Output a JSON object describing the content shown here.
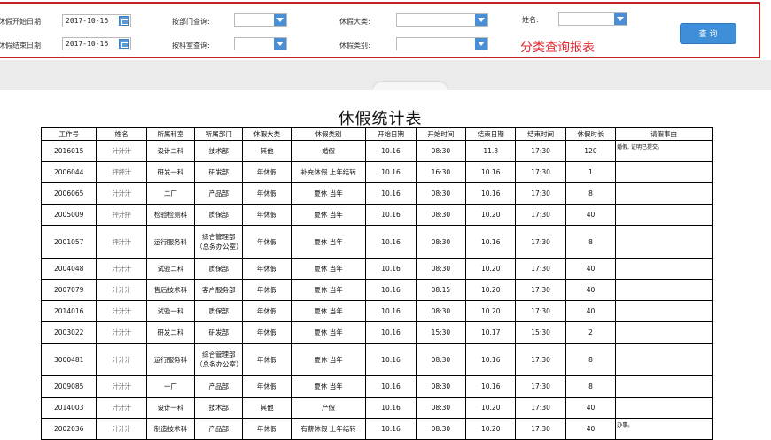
{
  "filters": {
    "start_date_label": "休假开始日期",
    "start_date_value": "2017-10-16",
    "end_date_label": "休假结束日期",
    "end_date_value": "2017-10-16",
    "dept_label": "按部门查询:",
    "section_label": "按科室查询:",
    "leave_cat_label": "休假大类:",
    "leave_type_label": "休假类别:",
    "name_label": "姓名:",
    "query_button": "查 询",
    "report_title": "分类查询报表"
  },
  "report": {
    "title": "休假统计表",
    "columns": [
      "工作号",
      "姓名",
      "所属科室",
      "所属部门",
      "休假大类",
      "休假类别",
      "开始日期",
      "开始时间",
      "结束日期",
      "结束时间",
      "休假时长",
      "请假事由"
    ],
    "rows": [
      {
        "id": "2016015",
        "name": "汁汁汁",
        "section": "设计二科",
        "dept": "技术部",
        "cat": "其他",
        "type": "婚假",
        "sdate": "10.16",
        "stime": "08:30",
        "edate": "11.3",
        "etime": "17:30",
        "hours": "120",
        "reason": "婚假, 证明已提交。"
      },
      {
        "id": "2006044",
        "name": "抨抨汁",
        "section": "研发一科",
        "dept": "研发部",
        "cat": "年休假",
        "type": "补充休假 上年结转",
        "sdate": "10.16",
        "stime": "16:30",
        "edate": "10.16",
        "etime": "17:30",
        "hours": "1",
        "reason": ""
      },
      {
        "id": "2006065",
        "name": "汁汁汁",
        "section": "二厂",
        "dept": "产品部",
        "cat": "年休假",
        "type": "夏休 当年",
        "sdate": "10.16",
        "stime": "08:30",
        "edate": "10.16",
        "etime": "17:30",
        "hours": "8",
        "reason": ""
      },
      {
        "id": "2005009",
        "name": "抨汁抨",
        "section": "检验检测科",
        "dept": "质保部",
        "cat": "年休假",
        "type": "夏休 当年",
        "sdate": "10.16",
        "stime": "08:30",
        "edate": "10.20",
        "etime": "17:30",
        "hours": "40",
        "reason": ""
      },
      {
        "id": "2001057",
        "name": "抨汁汁",
        "section": "运行服务科",
        "dept": "综合管理部（总务办公室）",
        "cat": "年休假",
        "type": "夏休 当年",
        "sdate": "10.16",
        "stime": "08:30",
        "edate": "10.16",
        "etime": "17:30",
        "hours": "8",
        "reason": "",
        "tall": true
      },
      {
        "id": "2004048",
        "name": "汁汁汁",
        "section": "试验二科",
        "dept": "质保部",
        "cat": "年休假",
        "type": "夏休 当年",
        "sdate": "10.16",
        "stime": "08:30",
        "edate": "10.20",
        "etime": "17:30",
        "hours": "40",
        "reason": ""
      },
      {
        "id": "2007079",
        "name": "汁汁汁",
        "section": "售后技术科",
        "dept": "客户服务部",
        "cat": "年休假",
        "type": "夏休 当年",
        "sdate": "10.16",
        "stime": "08:15",
        "edate": "10.20",
        "etime": "17:30",
        "hours": "40",
        "reason": ""
      },
      {
        "id": "2014016",
        "name": "汁汁汁",
        "section": "试验一科",
        "dept": "质保部",
        "cat": "年休假",
        "type": "夏休 当年",
        "sdate": "10.16",
        "stime": "08:30",
        "edate": "10.20",
        "etime": "17:30",
        "hours": "40",
        "reason": ""
      },
      {
        "id": "2003022",
        "name": "汁汁汁",
        "section": "研发二科",
        "dept": "研发部",
        "cat": "年休假",
        "type": "夏休 当年",
        "sdate": "10.16",
        "stime": "15:30",
        "edate": "10.17",
        "etime": "15:30",
        "hours": "2",
        "reason": ""
      },
      {
        "id": "3000481",
        "name": "汁汁汁",
        "section": "运行服务科",
        "dept": "综合管理部（总务办公室）",
        "cat": "年休假",
        "type": "夏休 当年",
        "sdate": "10.16",
        "stime": "08:30",
        "edate": "10.16",
        "etime": "17:30",
        "hours": "8",
        "reason": "",
        "tall": true
      },
      {
        "id": "2009085",
        "name": "汁汁汁",
        "section": "一厂",
        "dept": "产品部",
        "cat": "年休假",
        "type": "夏休 当年",
        "sdate": "10.16",
        "stime": "08:30",
        "edate": "10.16",
        "etime": "17:30",
        "hours": "8",
        "reason": ""
      },
      {
        "id": "2014003",
        "name": "汁汁汁",
        "section": "设计一科",
        "dept": "技术部",
        "cat": "其他",
        "type": "产假",
        "sdate": "10.16",
        "stime": "08:30",
        "edate": "10.20",
        "etime": "17:30",
        "hours": "40",
        "reason": ""
      },
      {
        "id": "2002036",
        "name": "汁汁汁",
        "section": "制造技术科",
        "dept": "产品部",
        "cat": "年休假",
        "type": "有薪休假 上年结转",
        "sdate": "10.16",
        "stime": "08:30",
        "edate": "10.20",
        "etime": "17:30",
        "hours": "40",
        "reason": "办事。"
      }
    ]
  }
}
